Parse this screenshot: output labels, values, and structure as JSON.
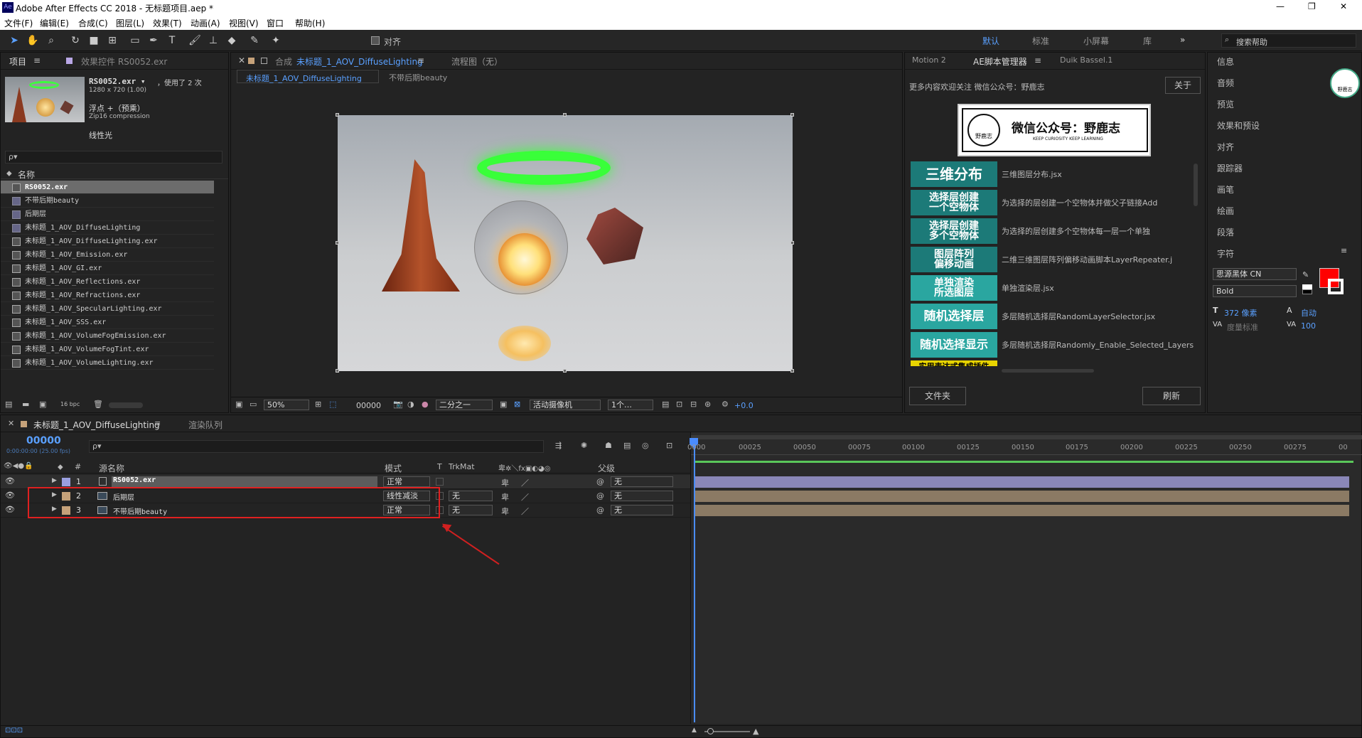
{
  "title_bar": {
    "app_icon": "Ae",
    "title": "Adobe After Effects CC 2018 - 无标题项目.aep *",
    "minimize": "—",
    "restore": "❐",
    "close": "✕"
  },
  "menu": [
    "文件(F)",
    "编辑(E)",
    "合成(C)",
    "图层(L)",
    "效果(T)",
    "动画(A)",
    "视图(V)",
    "窗口",
    "帮助(H)"
  ],
  "toolbar": {
    "align_label": "对齐",
    "workspaces": [
      "默认",
      "标准",
      "小屏幕",
      "库"
    ],
    "more": "»",
    "search_placeholder": "搜索帮助"
  },
  "project_panel": {
    "tab_project": "项目",
    "tab_effects": "效果控件 RS0052.exr",
    "item_name": "RS0052.exr ▾",
    "item_used": "，使用了 2 次",
    "item_size": "1280 x 720 (1.00)",
    "item_type": "浮点 +（预乘）",
    "item_compression": "Zip16 compression",
    "item_color": "线性光",
    "search_placeholder": "ρ▾",
    "col_name": "名称",
    "bpc": "16 bpc",
    "files": [
      "RS0052.exr",
      "不带后期beauty",
      "后期层",
      "未标题_1_AOV_DiffuseLighting",
      "未标题_1_AOV_DiffuseLighting.exr",
      "未标题_1_AOV_Emission.exr",
      "未标题_1_AOV_GI.exr",
      "未标题_1_AOV_Reflections.exr",
      "未标题_1_AOV_Refractions.exr",
      "未标题_1_AOV_SpecularLighting.exr",
      "未标题_1_AOV_SSS.exr",
      "未标题_1_AOV_VolumeFogEmission.exr",
      "未标题_1_AOV_VolumeFogTint.exr",
      "未标题_1_AOV_VolumeLighting.exr"
    ]
  },
  "comp_panel": {
    "tab_comp_prefix": "合成",
    "comp_name": "未标题_1_AOV_DiffuseLighting",
    "flow_tab": "流程图（无）",
    "sub_tab1": "未标题_1_AOV_DiffuseLighting",
    "sub_tab2": "不带后期beauty",
    "footer": {
      "zoom": "50%",
      "timecode": "00000",
      "resolution": "二分之一",
      "camera": "活动摄像机",
      "views": "1个…",
      "exposure": "+0.0"
    }
  },
  "script_panel": {
    "tabs": [
      "Motion 2",
      "AE脚本管理器",
      "Duik Bassel.1"
    ],
    "notice": "更多内容欢迎关注 微信公众号：野鹿志",
    "about": "关于",
    "banner_title": "微信公众号：野鹿志",
    "banner_sub": "KEEP CURIOSITY KEEP LEARNING",
    "logo_text": "野鹿志",
    "scripts": [
      {
        "btn": "三维分布",
        "desc": "三维图层分布.jsx",
        "color": "#1c7a78"
      },
      {
        "btn": "选择层创建\n一个空物体",
        "desc": "为选择的层创建一个空物体并做父子链接Add",
        "color": "#1c7a78"
      },
      {
        "btn": "选择层创建\n多个空物体",
        "desc": "为选择的层创建多个空物体每一层一个单独",
        "color": "#1c7a78"
      },
      {
        "btn": "图层阵列\n偏移动画",
        "desc": "二维三维图层阵列偏移动画脚本LayerRepeater.j",
        "color": "#1c7a78"
      },
      {
        "btn": "单独渲染\n所选图层",
        "desc": "单独渲染层.jsx",
        "color": "#2aa6a0"
      },
      {
        "btn": "随机选择层",
        "desc": "多层随机选择层RandomLayerSelector.jsx",
        "color": "#2aa6a0"
      },
      {
        "btn": "随机选择显示",
        "desc": "多层随机选择层Randomly_Enable_Selected_Layers",
        "color": "#2aa6a0"
      },
      {
        "btn": "实用表达式集成插件",
        "desc": "",
        "color": "#e8d400"
      }
    ],
    "folder_btn": "文件夹",
    "refresh_btn": "刷新"
  },
  "right_panel": {
    "items": [
      "信息",
      "音频",
      "预览",
      "效果和预设",
      "对齐",
      "跟踪器",
      "画笔",
      "绘画",
      "段落",
      "字符"
    ],
    "font": "思源黑体 CN",
    "style": "Bold",
    "size": "372 像素",
    "leading": "自动",
    "kerning": "度量标准",
    "tracking": "100",
    "logo": "野鹿志",
    "fill_color": "#ff0000"
  },
  "timeline": {
    "tab_comp": "未标题_1_AOV_DiffuseLighting",
    "tab_render": "渲染队列",
    "timecode": "00000",
    "fps": "0:00:00:00 (25.00 fps)",
    "search_placeholder": "ρ▾",
    "col_source": "源名称",
    "col_mode": "模式",
    "col_t": "T",
    "col_trkmat": "TrkMat",
    "col_parent": "父级",
    "layers": [
      {
        "num": "1",
        "name": "RS0052.exr",
        "mode": "正常",
        "trkmat": "",
        "parent": "无",
        "color": "#9a9fe0",
        "bar": "#8a87b8"
      },
      {
        "num": "2",
        "name": "后期层",
        "mode": "线性减淡",
        "trkmat": "无",
        "parent": "无",
        "color": "#c6a27a",
        "bar": "#8b7a64"
      },
      {
        "num": "3",
        "name": "不带后期beauty",
        "mode": "正常",
        "trkmat": "无",
        "parent": "无",
        "color": "#c6a27a",
        "bar": "#8b7a64"
      }
    ],
    "ruler": [
      "0000",
      "00025",
      "00050",
      "00075",
      "00100",
      "00125",
      "00150",
      "00175",
      "00200",
      "00225",
      "00250",
      "00275",
      "00"
    ]
  }
}
